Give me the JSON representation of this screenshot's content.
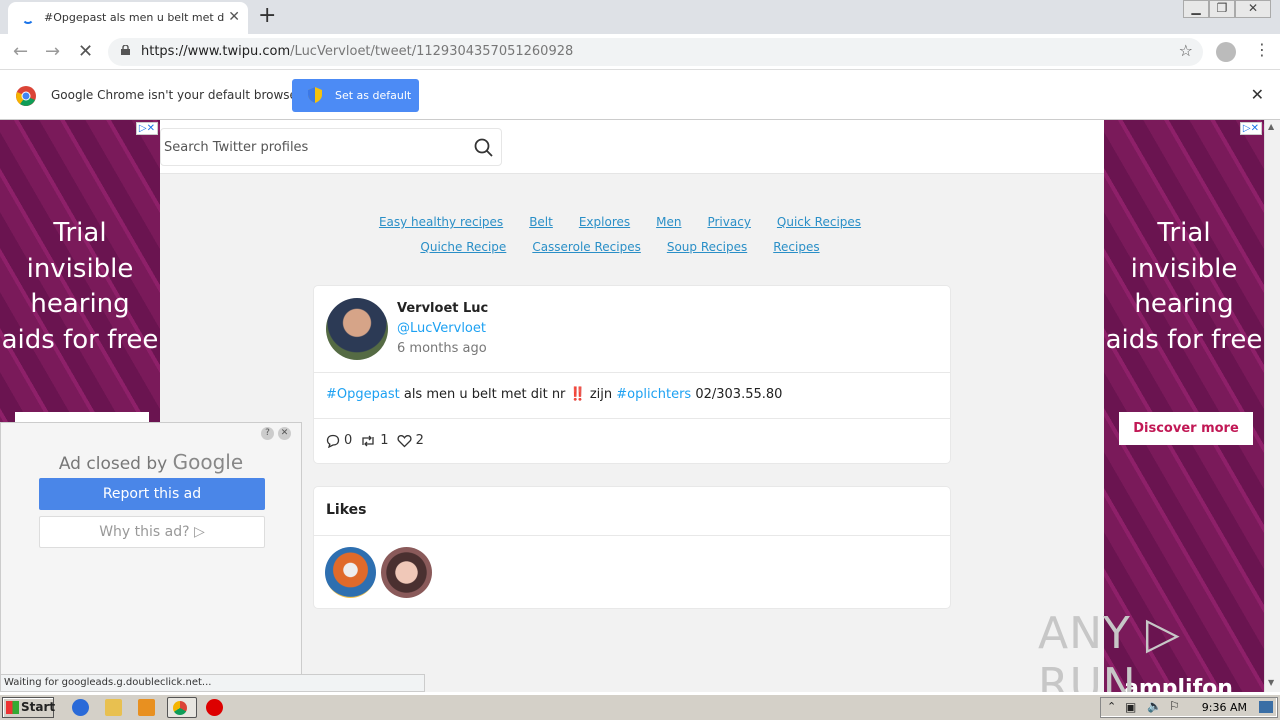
{
  "browser": {
    "tab_title": "#Opgepast als men u belt met dit nr",
    "url_host": "https://www.twipu.com",
    "url_path": "/LucVervloet/tweet/1129304357051260928",
    "infobar_message": "Google Chrome isn't your default browser",
    "infobar_button": "Set as default"
  },
  "page": {
    "search_placeholder": "Search Twitter profiles",
    "links": [
      "Easy healthy recipes",
      "Belt",
      "Explores",
      "Men",
      "Privacy",
      "Quick Recipes",
      "Quiche Recipe",
      "Casserole Recipes",
      "Soup Recipes",
      "Recipes"
    ],
    "tweet": {
      "name": "Vervloet Luc",
      "handle": "@LucVervloet",
      "time": "6 months ago",
      "hashtag1": "#Opgepast",
      "text_mid": " als men u belt met dit nr ‼️ zijn ",
      "hashtag2": "#oplichters",
      "text_end": " 02/303.55.80",
      "replies": "0",
      "retweets": "1",
      "likes": "2"
    },
    "likes_title": "Likes"
  },
  "ads": {
    "copy": "Trial invisible hearing aids for free",
    "cta": "Discover more",
    "bottom_text": "amplifon"
  },
  "ad_closed": {
    "heading_prefix": "Ad closed by",
    "heading_brand": "Google",
    "report": "Report this ad",
    "why": "Why this ad? ▷"
  },
  "status_text": "Waiting for googleads.g.doubleclick.net...",
  "watermark": "ANY ▷ RUN",
  "taskbar": {
    "start": "Start",
    "clock": "9:36 AM"
  }
}
